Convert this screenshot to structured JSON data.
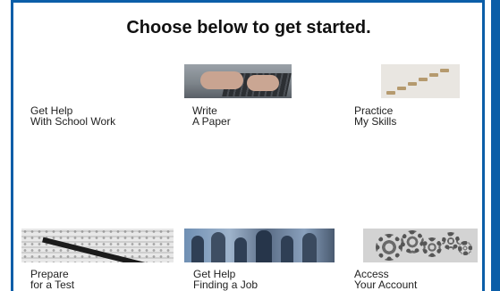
{
  "heading": "Choose below to get started.",
  "tiles": [
    {
      "line1": "Get Help",
      "line2": "With School Work",
      "image": "none"
    },
    {
      "line1": "Write",
      "line2": "A Paper",
      "image": "laptop-typing-photo"
    },
    {
      "line1": "Practice",
      "line2": "My Skills",
      "image": "stairs-photo"
    },
    {
      "line1": "Prepare",
      "line2": "for a Test",
      "image": "answer-sheet-photo"
    },
    {
      "line1": "Get Help",
      "line2": "Finding a Job",
      "image": "job-crowd-photo"
    },
    {
      "line1": "Access",
      "line2": "Your Account",
      "image": "gears-photo"
    }
  ],
  "colors": {
    "frame": "#0b5ea8",
    "text": "#222222"
  }
}
